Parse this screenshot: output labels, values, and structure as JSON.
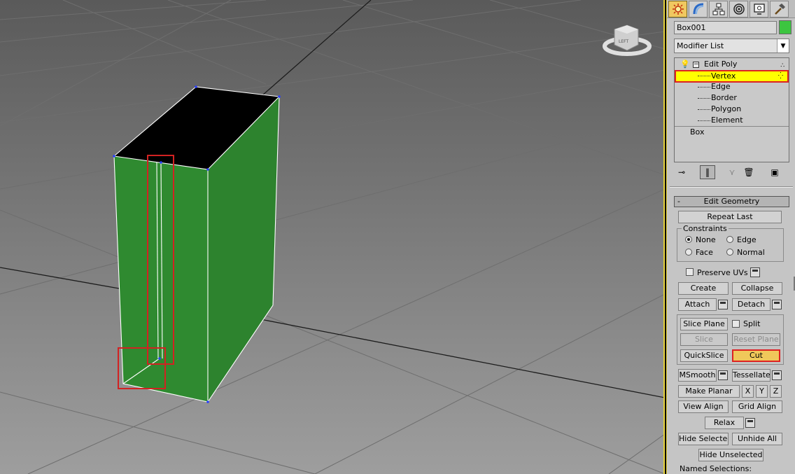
{
  "colors": {
    "accent": "#e6d33a",
    "object": "#2f8a30",
    "swatch": "#3cc540",
    "selection_red": "#d22222",
    "highlight_yellow": "#ffff00",
    "cut_button": "#f0c85a"
  },
  "tabs": [
    {
      "icon": "create-icon",
      "active": true
    },
    {
      "icon": "modify-icon",
      "active": false
    },
    {
      "icon": "hierarchy-icon",
      "active": false
    },
    {
      "icon": "motion-icon",
      "active": false
    },
    {
      "icon": "display-icon",
      "active": false
    },
    {
      "icon": "utilities-icon",
      "active": false
    }
  ],
  "object": {
    "name": "Box001"
  },
  "modifier_list": {
    "label": "Modifier List"
  },
  "stack": {
    "edit_poly": "Edit Poly",
    "vertex": "Vertex",
    "edge": "Edge",
    "border": "Border",
    "polygon": "Polygon",
    "element": "Element",
    "box": "Box"
  },
  "viewcube": {
    "face_label": "LEFT"
  },
  "edit_geometry": {
    "title": "Edit Geometry",
    "collapse_sign": "-",
    "repeat_last": "Repeat Last",
    "constraints_title": "Constraints",
    "none": "None",
    "edge": "Edge",
    "face": "Face",
    "normal": "Normal",
    "preserve_uvs": "Preserve UVs",
    "create": "Create",
    "collapse": "Collapse",
    "attach": "Attach",
    "detach": "Detach",
    "slice_plane": "Slice Plane",
    "split": "Split",
    "slice": "Slice",
    "reset_plane": "Reset Plane",
    "quickslice": "QuickSlice",
    "cut": "Cut",
    "msmooth": "MSmooth",
    "tessellate": "Tessellate",
    "make_planar": "Make Planar",
    "x": "X",
    "y": "Y",
    "z": "Z",
    "view_align": "View Align",
    "grid_align": "Grid Align",
    "relax": "Relax",
    "hide_selected": "Hide Selected",
    "unhide_all": "Unhide All",
    "hide_unselected": "Hide Unselected",
    "named_selections": "Named Selections:"
  }
}
